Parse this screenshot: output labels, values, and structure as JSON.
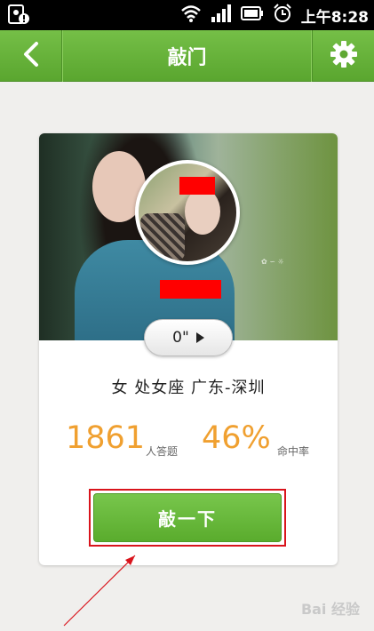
{
  "status_bar": {
    "time": "上午8:28"
  },
  "nav": {
    "title": "敲门",
    "back_icon": "back-chevron-icon",
    "settings_icon": "gear-icon"
  },
  "profile": {
    "voice_duration": "0\"",
    "info": "女  处女座 广东-深圳",
    "answers_count": "1861",
    "answers_label": "人答题",
    "hit_rate": "46%",
    "hit_rate_label": "命中率"
  },
  "action": {
    "knock_label": "敲一下"
  },
  "watermark": {
    "baidu": "Bai 经验"
  },
  "colors": {
    "nav_green": "#5aa62f",
    "stat_orange": "#f0a030",
    "highlight_red": "#d9141c"
  }
}
